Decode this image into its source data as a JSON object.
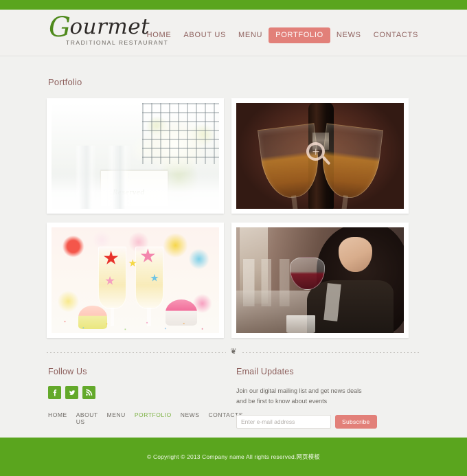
{
  "header": {
    "logo": {
      "initial": "G",
      "rest": "ourmet",
      "tagline": "TRADITIONAL RESTAURANT"
    },
    "nav": [
      {
        "label": "HOME",
        "active": false
      },
      {
        "label": "ABOUT US",
        "active": false
      },
      {
        "label": "MENU",
        "active": false
      },
      {
        "label": "PORTFOLIO",
        "active": true
      },
      {
        "label": "NEWS",
        "active": false
      },
      {
        "label": "CONTACTS",
        "active": false
      }
    ]
  },
  "main": {
    "page_title": "Portfolio",
    "items": [
      {
        "name": "wedding-table-setting",
        "alt": "White roses and champagne flutes on a reserved table",
        "card_text": "Reserved",
        "hover_zoom": false
      },
      {
        "name": "wine-bottle-and-glasses",
        "alt": "Two glasses of white wine in front of a dark wine bottle",
        "hover_zoom": true
      },
      {
        "name": "party-champagne-stars",
        "alt": "Colorful party table with champagne glasses, stars and cupcakes",
        "hover_zoom": false
      },
      {
        "name": "woman-with-wine-glass",
        "alt": "Woman holding a glass of red wine in a restaurant",
        "hover_zoom": false
      }
    ]
  },
  "footer": {
    "ornament": "❦",
    "follow": {
      "title": "Follow Us",
      "social": [
        {
          "name": "facebook-icon",
          "glyph": "f"
        },
        {
          "name": "twitter-icon",
          "glyph": "t"
        },
        {
          "name": "rss-icon",
          "glyph": "•"
        }
      ],
      "nav": [
        {
          "label": "HOME",
          "active": false
        },
        {
          "label": "ABOUT US",
          "active": false
        },
        {
          "label": "MENU",
          "active": false
        },
        {
          "label": "PORTFOLIO",
          "active": true
        },
        {
          "label": "NEWS",
          "active": false
        },
        {
          "label": "CONTACTS",
          "active": false
        }
      ]
    },
    "updates": {
      "title": "Email Updates",
      "text": "Join our digital mailing list and get news deals and be first to know about events",
      "email_placeholder": "Enter e-mail address",
      "email_value": "",
      "subscribe_label": "Subscribe"
    },
    "copyright": "© Copyright © 2013 Company name All rights reserved.网页模板"
  },
  "colors": {
    "green": "#5aa51e",
    "social_green": "#63a92a",
    "accent_red": "#e28079",
    "heading": "#8d5f5c",
    "body_bg": "#f1f1ef"
  }
}
